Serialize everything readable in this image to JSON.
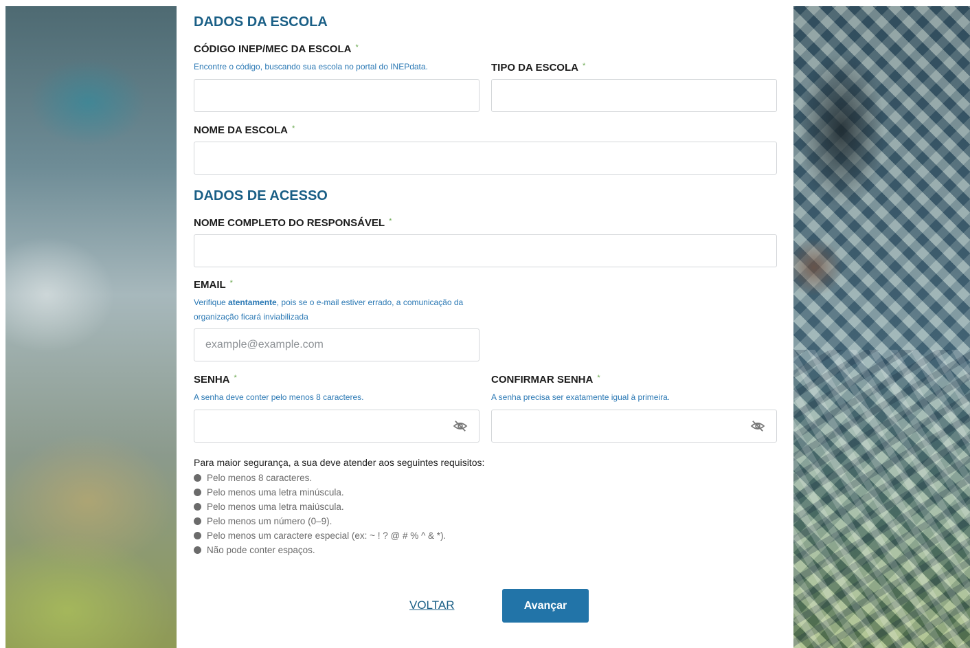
{
  "school_section": {
    "title": "DADOS DA ESCOLA",
    "inep_label": "CÓDIGO INEP/MEC DA ESCOLA",
    "inep_hint": "Encontre o código, buscando sua escola no portal do INEPdata.",
    "inep_value": "",
    "type_label": "TIPO DA ESCOLA",
    "type_value": "",
    "name_label": "NOME DA ESCOLA",
    "name_value": "",
    "required_mark": "*"
  },
  "access_section": {
    "title": "DADOS DE ACESSO",
    "responsible_label": "NOME COMPLETO DO RESPONSÁVEL",
    "responsible_value": "",
    "email_label": "EMAIL",
    "email_hint_pre": "Verifique ",
    "email_hint_bold": "atentamente",
    "email_hint_post": ", pois se o e-mail estiver errado, a comunicação da organização ficará inviabilizada",
    "email_placeholder": "example@example.com",
    "password_label": "SENHA",
    "password_hint": "A senha deve conter pelo menos 8 caracteres.",
    "confirm_label": "CONFIRMAR SENHA",
    "confirm_hint": "A senha precisa ser exatamente igual à primeira.",
    "eye_icon": "eye-off-icon"
  },
  "requirements": {
    "intro": "Para maior segurança, a sua deve atender aos seguintes requisitos:",
    "items": [
      "Pelo menos 8 caracteres.",
      "Pelo menos uma letra minúscula.",
      "Pelo menos uma letra maiúscula.",
      "Pelo menos um número (0–9).",
      "Pelo menos um caractere especial (ex: ~ ! ? @ # % ^ & *).",
      "Não pode conter espaços."
    ]
  },
  "actions": {
    "back_label": "VOLTAR",
    "next_label": "Avançar"
  },
  "colors": {
    "accent": "#1a5f86",
    "button": "#2274a8",
    "hint": "#2a78b4",
    "required": "#6aa84f"
  }
}
